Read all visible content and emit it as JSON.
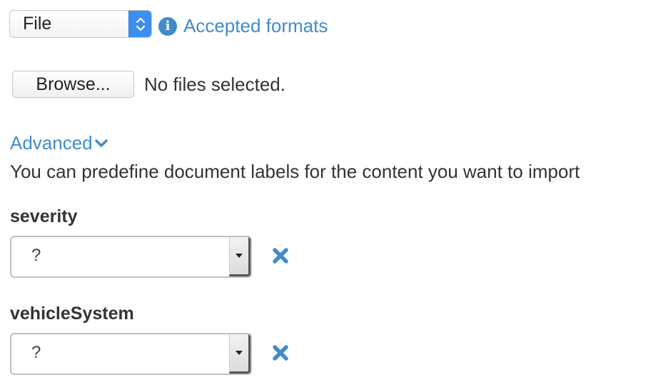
{
  "source": {
    "selected": "File",
    "info_label": "Accepted formats"
  },
  "file_input": {
    "button_label": "Browse...",
    "status": "No files selected."
  },
  "advanced": {
    "label": "Advanced",
    "help_text": "You can predefine document labels for the content you want to import"
  },
  "labels": [
    {
      "name": "severity",
      "value": "?"
    },
    {
      "name": "vehicleSystem",
      "value": "?"
    }
  ],
  "colors": {
    "link": "#428bca",
    "stepper": "#3b8ff0",
    "remove": "#428bca"
  },
  "icons": {
    "info": "info-circle-icon",
    "chevron": "chevron-down-icon",
    "remove": "times-icon"
  }
}
